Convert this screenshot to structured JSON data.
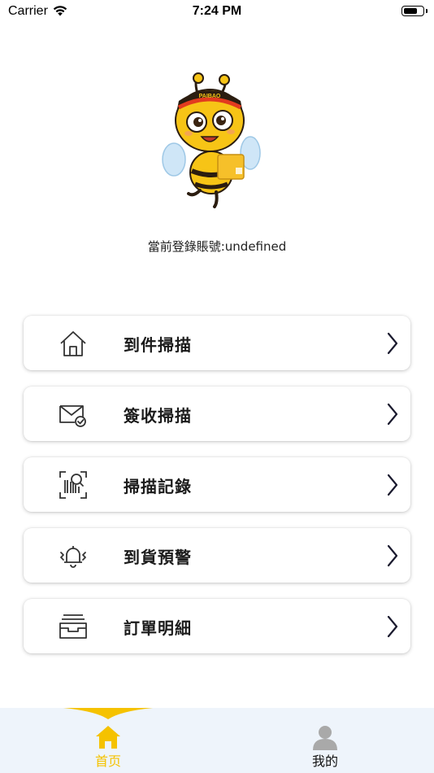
{
  "status_bar": {
    "carrier": "Carrier",
    "time": "7:24 PM",
    "wifi_icon": "wifi-icon",
    "battery_icon": "battery-icon",
    "battery_level": 0.7
  },
  "header": {
    "mascot_icon": "bee-mascot",
    "mascot_hat_text": "PAIBAO",
    "account_text": "當前登錄賬號:undefined"
  },
  "menu": {
    "items": [
      {
        "label": "到件掃描",
        "icon": "house-icon"
      },
      {
        "label": "簽收掃描",
        "icon": "envelope-check-icon"
      },
      {
        "label": "掃描記錄",
        "icon": "barcode-scan-icon"
      },
      {
        "label": "到貨預警",
        "icon": "bell-icon"
      },
      {
        "label": "訂單明細",
        "icon": "inbox-tray-icon"
      }
    ],
    "chevron_icon": "chevron-right-icon"
  },
  "tabbar": {
    "tabs": [
      {
        "label": "首页",
        "icon": "home-icon",
        "active": true
      },
      {
        "label": "我的",
        "icon": "user-icon",
        "active": false
      }
    ],
    "active_color": "#f5c200",
    "background": "#eef4fb"
  }
}
